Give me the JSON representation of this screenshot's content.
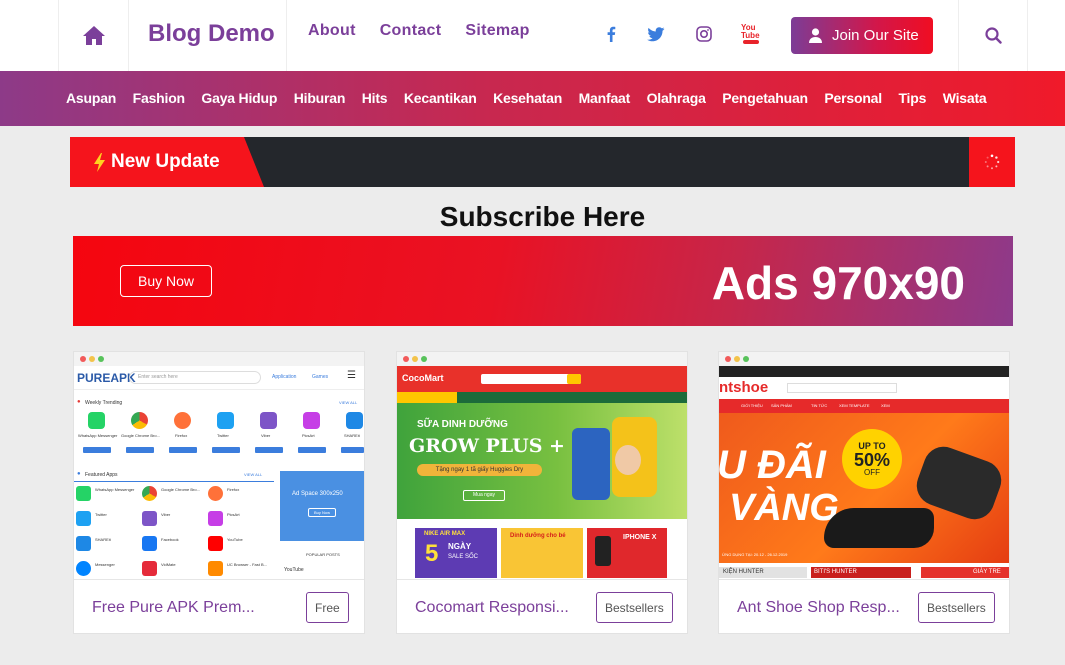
{
  "header": {
    "logo": "Blog Demo",
    "nav": [
      "About",
      "Contact",
      "Sitemap"
    ],
    "join_label": "Join Our Site",
    "social_icons": [
      "facebook-icon",
      "twitter-icon",
      "instagram-icon",
      "youtube-icon"
    ],
    "youtube_text": "You Tube"
  },
  "categories": [
    "Asupan",
    "Fashion",
    "Gaya Hidup",
    "Hiburan",
    "Hits",
    "Kecantikan",
    "Kesehatan",
    "Manfaat",
    "Olahraga",
    "Pengetahuan",
    "Personal",
    "Tips",
    "Wisata"
  ],
  "ticker": {
    "label": "New Update"
  },
  "subscribe": {
    "title": "Subscribe Here"
  },
  "ads": {
    "button": "Buy Now",
    "text": "Ads 970x90"
  },
  "cards": [
    {
      "title": "Free Pure APK Prem...",
      "tag": "Free",
      "thumb": {
        "brand": "PUREAPK",
        "search_placeholder": "Enter search here",
        "nav_application": "Application",
        "nav_games": "Games",
        "section1": "Weekly Trending",
        "view_all": "VIEW ALL",
        "apps_row": [
          "WhatsApp Messenger",
          "Google Chrome Bro...",
          "Firefox",
          "Twitter",
          "Viber",
          "PicsArt",
          "SHAREit"
        ],
        "section2": "Featured Apps",
        "featured_left": [
          "WhatsApp Messenger",
          "Twitter",
          "SHAREit",
          "Messenger"
        ],
        "featured_mid": [
          "Google Chrome Bro...",
          "Viber",
          "Facebook",
          "VidMate"
        ],
        "featured_right": [
          "Firefox",
          "PicsArt",
          "YouTube",
          "UC Browser - Fast B..."
        ],
        "download": "Download",
        "ad_space": "Ad Space 300x250",
        "ad_button": "Buy Now",
        "popular_posts": "POPULAR POSTS",
        "youtube_small": "YouTube"
      }
    },
    {
      "title": "Cocomart Responsi...",
      "tag": "Bestsellers",
      "thumb": {
        "brand": "CocoMart",
        "banner_title": "SỮA DINH DƯỠNG",
        "banner_product": "GROW PLUS +",
        "banner_sub": "Tặng ngay 1 tã giấy Huggies Dry",
        "banner_button": "Mua ngay",
        "promo1_a": "NIKE AIR MAX",
        "promo1_num": "5",
        "promo1_b": "NGÀY",
        "promo1_c": "SALE SỐC",
        "promo2": "Dinh dưỡng cho bé",
        "promo3": "IPHONE X"
      }
    },
    {
      "title": "Ant Shoe Shop Resp...",
      "tag": "Bestsellers",
      "thumb": {
        "brand": "ntshoe",
        "menu": [
          "GIỚI THIỆU",
          "SẢN PHẨM",
          "TIN TỨC",
          "XEM TEMPLATE",
          "XEM"
        ],
        "banner_a": "U ĐÃI",
        "banner_b": "VÀNG",
        "badge_a": "UP TO",
        "badge_b": "50%",
        "badge_c": "OFF",
        "date": "ỨNG DỤNG TẠI: 20.12 - 26.12.2019",
        "tiles": [
          "KIỆN HUNTER",
          "BITI'S HUNTER",
          "GIÀY TRE"
        ]
      }
    }
  ],
  "colors": {
    "purple": "#7b3f9a",
    "red": "#f5141c",
    "dark": "#24272c"
  }
}
